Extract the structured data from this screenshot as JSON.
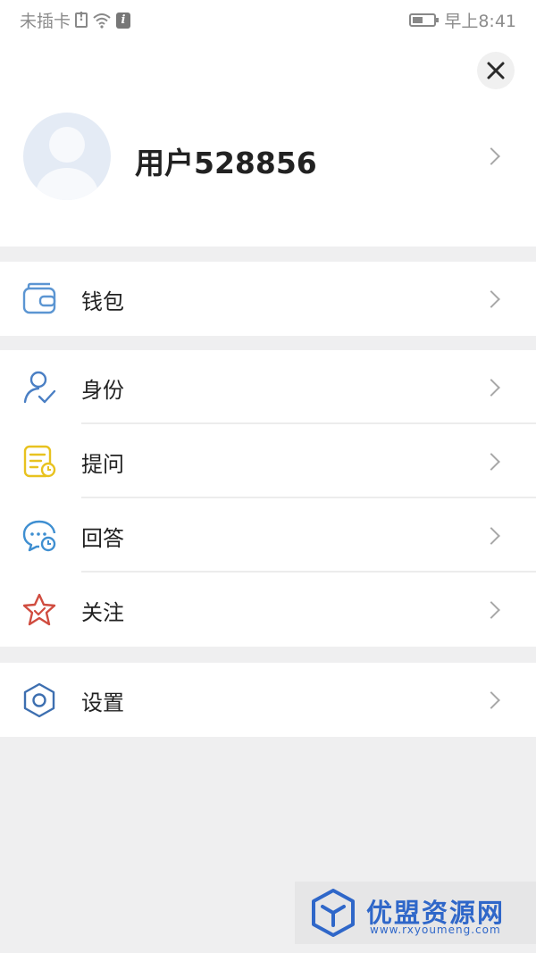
{
  "status_bar": {
    "carrier": "未插卡",
    "time": "早上8:41"
  },
  "profile": {
    "username": "用户528856"
  },
  "menu": {
    "wallet": {
      "label": "钱包",
      "icon": "wallet-icon",
      "color": "#5b95d2"
    },
    "identity": {
      "label": "身份",
      "icon": "user-check-icon",
      "color": "#4a7fc4"
    },
    "questions": {
      "label": "提问",
      "icon": "question-list-icon",
      "color": "#e8c21f"
    },
    "answers": {
      "label": "回答",
      "icon": "chat-clock-icon",
      "color": "#3f8fd1"
    },
    "follow": {
      "label": "关注",
      "icon": "star-icon",
      "color": "#d04c3f"
    },
    "settings": {
      "label": "设置",
      "icon": "hexagon-settings-icon",
      "color": "#3d6fb0"
    }
  },
  "watermark": {
    "title": "优盟资源网",
    "url": "www.rxyoumeng.com",
    "color": "#2f67c9"
  }
}
